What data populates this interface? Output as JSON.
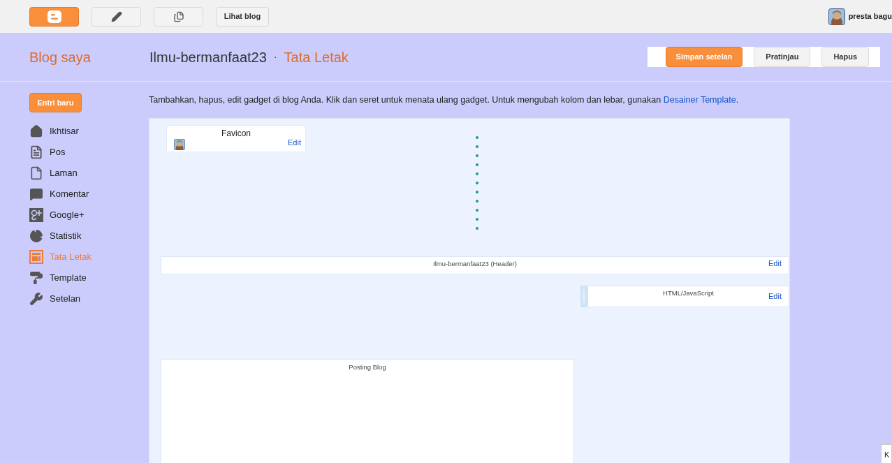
{
  "top_bar": {
    "view_blog_button": "Lihat blog",
    "user_name": "presta bagu"
  },
  "header": {
    "my_blog": "Blog saya",
    "blog_title": "Ilmu-bermanfaat23",
    "separator": "·",
    "page_title": "Tata Letak",
    "buttons": [
      {
        "label": "Simpan setelan",
        "kind": "primary"
      },
      {
        "label": "Pratinjau",
        "kind": "secondary"
      },
      {
        "label": "Hapus",
        "kind": "secondary"
      }
    ]
  },
  "sidebar": {
    "new_post_button": "Entri baru",
    "items": [
      {
        "label": "Ikhtisar",
        "selected": false
      },
      {
        "label": "Pos",
        "selected": false
      },
      {
        "label": "Laman",
        "selected": false
      },
      {
        "label": "Komentar",
        "selected": false
      },
      {
        "label": "Google+",
        "selected": false
      },
      {
        "label": "Statistik",
        "selected": false
      },
      {
        "label": "Tata Letak",
        "selected": true
      },
      {
        "label": "Template",
        "selected": false
      },
      {
        "label": "Setelan",
        "selected": false
      }
    ]
  },
  "description": {
    "text": "Tambahkan, hapus, edit gadget di blog Anda. Klik dan seret untuk menata ulang gadget. Untuk mengubah kolom dan lebar, gunakan",
    "link": "Desainer Template",
    "end": "."
  },
  "layout": {
    "favicon": {
      "title": "Favicon",
      "edit": "Edit"
    },
    "header_gadget": {
      "title": "Ilmu-bermanfaat23 (Header)",
      "edit": "Edit"
    },
    "html_gadget": {
      "title": "HTML/JavaScript",
      "edit": "Edit"
    },
    "posts_gadget": {
      "title": "Posting Blog"
    }
  },
  "corner_tab": "K"
}
